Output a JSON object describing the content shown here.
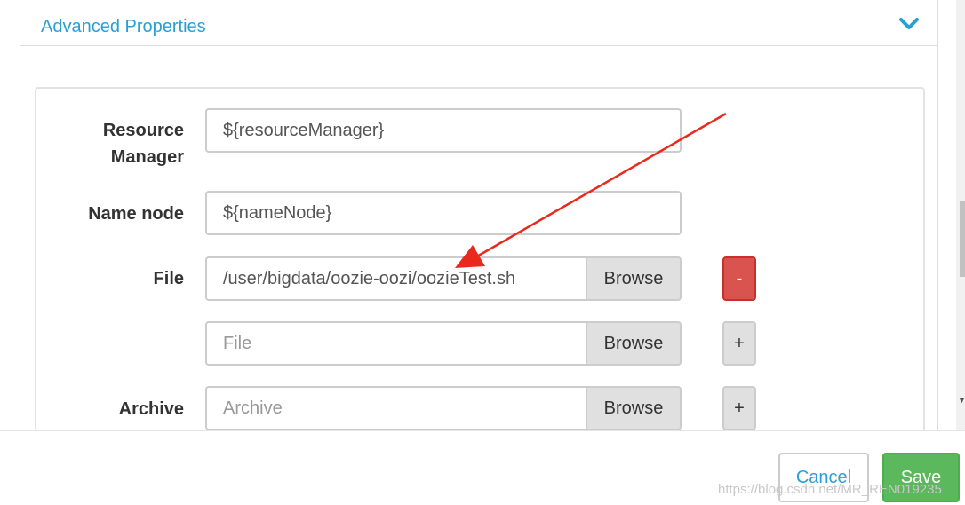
{
  "panel": {
    "title": "Advanced Properties",
    "collapse_icon": "chevron-down-icon",
    "accent_color": "#2a9fd6"
  },
  "form": {
    "resource_manager": {
      "label_line1": "Resource",
      "label_line2": "Manager",
      "value": "${resourceManager}"
    },
    "name_node": {
      "label": "Name node",
      "value": "${nameNode}"
    },
    "file": {
      "label": "File",
      "entries": [
        {
          "value": "/user/bigdata/oozie-oozi/oozieTest.sh",
          "button": "Browse",
          "action": "-"
        },
        {
          "placeholder": "File",
          "button": "Browse",
          "action": "+"
        }
      ]
    },
    "archive": {
      "label": "Archive",
      "placeholder": "Archive",
      "button": "Browse",
      "action": "+"
    }
  },
  "footer": {
    "cancel_label": "Cancel",
    "save_label": "Save",
    "watermark": "https://blog.csdn.net/MR_REN019235"
  },
  "colors": {
    "danger": "#d9534f",
    "success": "#5cb85c",
    "annotation_arrow": "#e8291c"
  }
}
